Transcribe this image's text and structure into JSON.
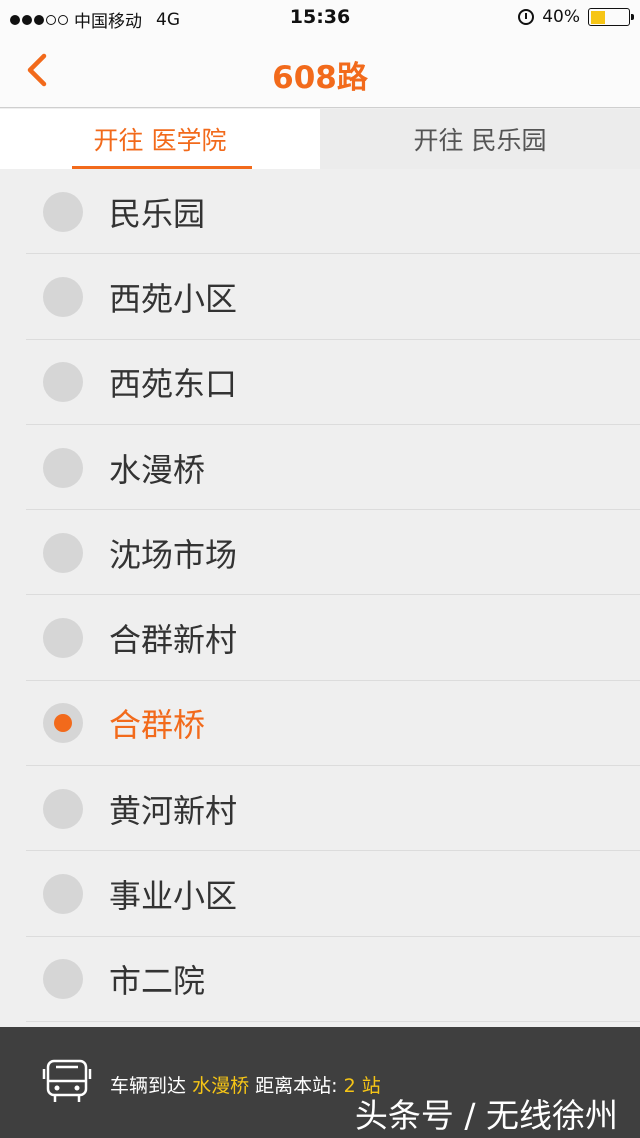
{
  "status_bar": {
    "carrier": "中国移动",
    "network": "4G",
    "time": "15:36",
    "battery": "40%",
    "battery_level": 0.4
  },
  "nav": {
    "title": "608路",
    "back_icon": "chevron-left-icon"
  },
  "tabs": [
    {
      "label": "开往 医学院",
      "active": true
    },
    {
      "label": "开往 民乐园",
      "active": false
    }
  ],
  "stops": [
    {
      "name": "民乐园",
      "current": false
    },
    {
      "name": "西苑小区",
      "current": false
    },
    {
      "name": "西苑东口",
      "current": false
    },
    {
      "name": "水漫桥",
      "current": false
    },
    {
      "name": "沈场市场",
      "current": false
    },
    {
      "name": "合群新村",
      "current": false
    },
    {
      "name": "合群桥",
      "current": true
    },
    {
      "name": "黄河新村",
      "current": false
    },
    {
      "name": "事业小区",
      "current": false
    },
    {
      "name": "市二院",
      "current": false
    }
  ],
  "bottom": {
    "prefix": "车辆到达",
    "station": "水漫桥",
    "middle": "距离本站:",
    "distance": "2 站",
    "watermark": "头条号 / 无线徐州"
  },
  "colors": {
    "accent": "#f26a1b",
    "highlight": "#f6c516",
    "bottom_bg": "#3f3f3f"
  }
}
